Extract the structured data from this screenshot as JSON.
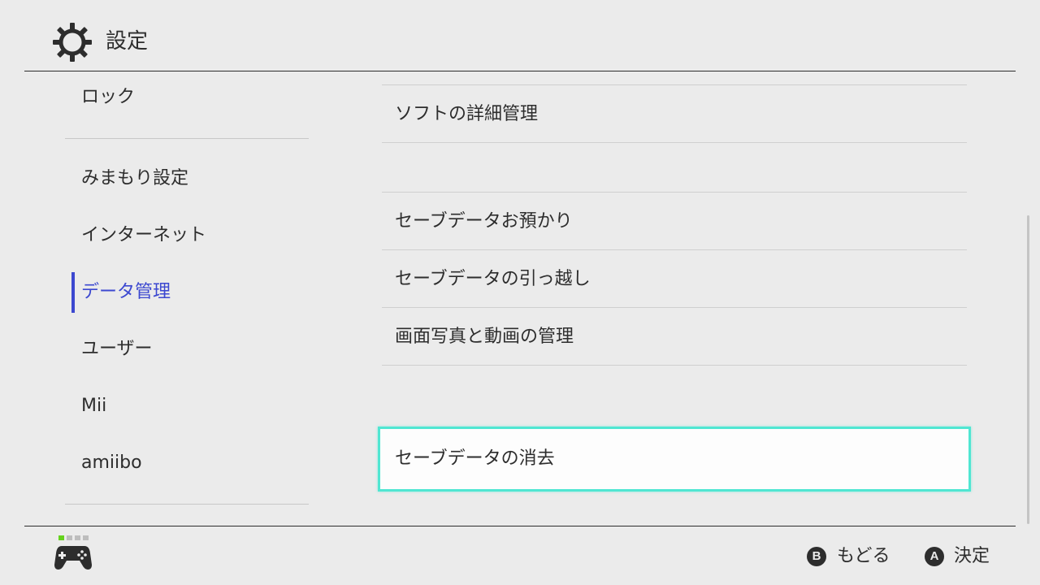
{
  "header": {
    "title": "設定",
    "icon": "gear-icon"
  },
  "sidebar": {
    "items": [
      {
        "label": "ロック"
      },
      {
        "label": "みまもり設定"
      },
      {
        "label": "インターネット"
      },
      {
        "label": "データ管理",
        "active": true
      },
      {
        "label": "ユーザー"
      },
      {
        "label": "Mii"
      },
      {
        "label": "amiibo"
      }
    ],
    "active_color": "#3c48d0"
  },
  "main": {
    "items": [
      {
        "label": "ソフトの詳細管理"
      },
      {
        "label": "セーブデータお預かり"
      },
      {
        "label": "セーブデータの引っ越し"
      },
      {
        "label": "画面写真と動画の管理"
      },
      {
        "label": "セーブデータの消去",
        "selected": true
      }
    ],
    "highlight_color": "#50e6d2"
  },
  "footer": {
    "controller_icon": "controller-icon",
    "back": {
      "button": "B",
      "label": "もどる"
    },
    "confirm": {
      "button": "A",
      "label": "決定"
    },
    "player_indicator_color": "#65d21e"
  }
}
